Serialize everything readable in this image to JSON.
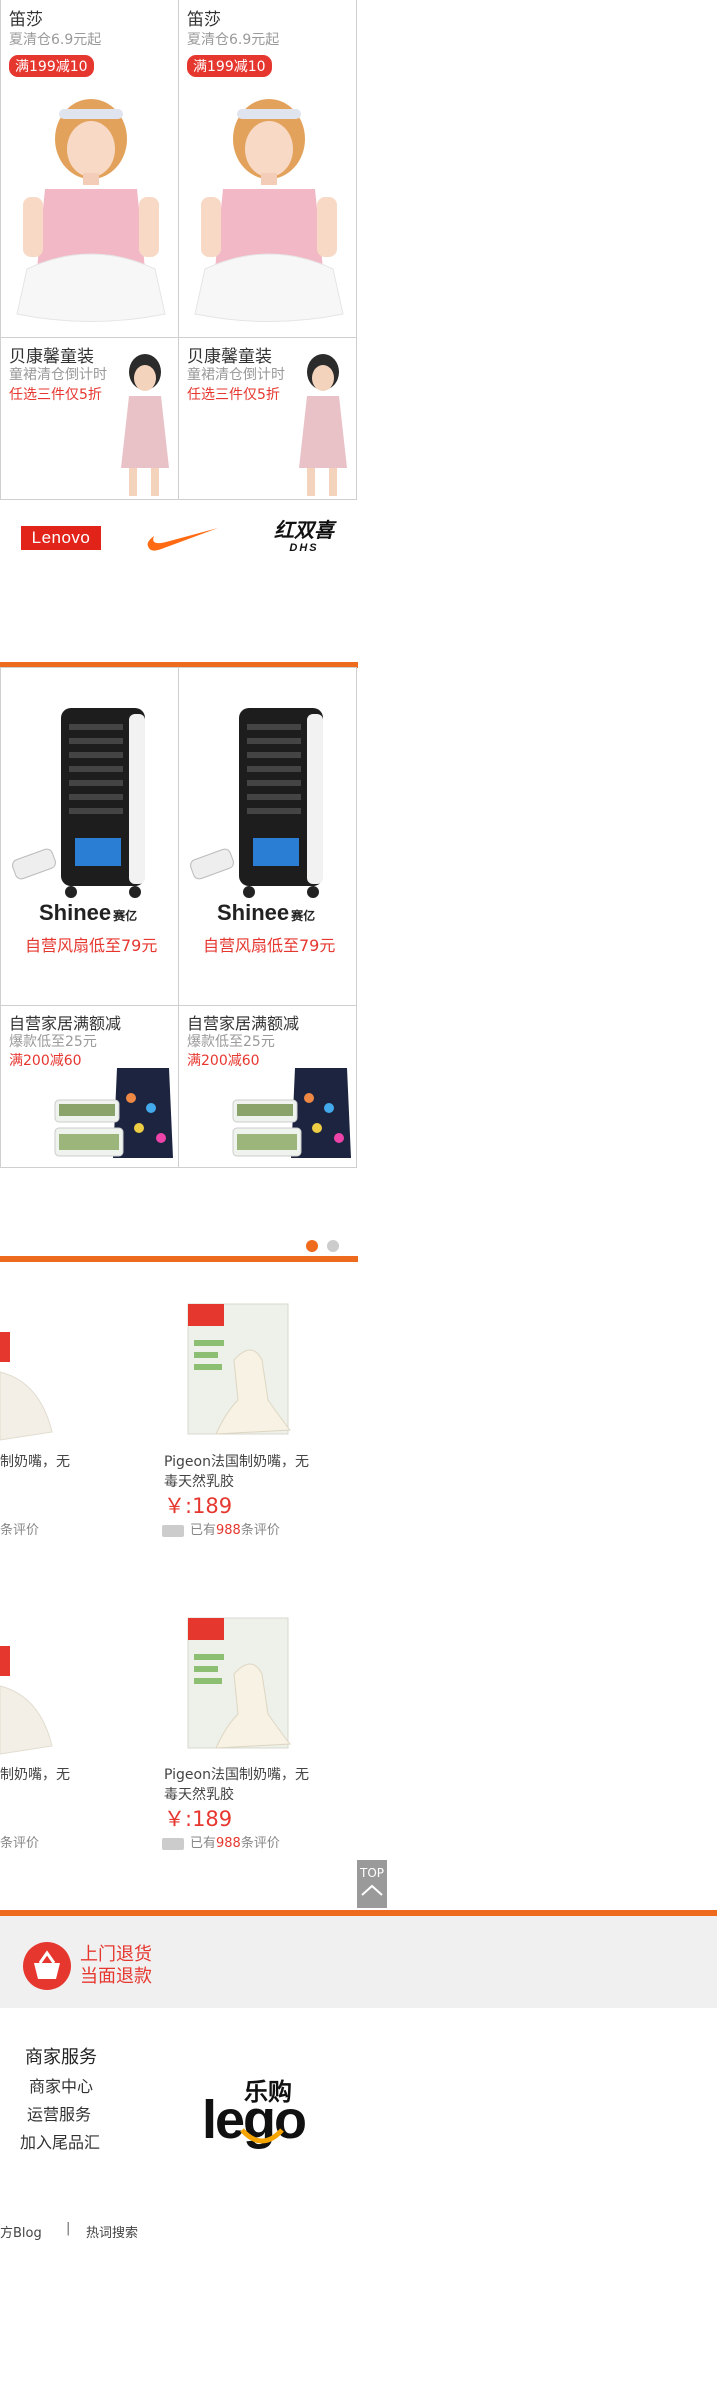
{
  "promo_top": {
    "cells": [
      {
        "title": "笛莎",
        "subtitle": "夏清仓6.9元起",
        "badge": "满199减10"
      },
      {
        "title": "笛莎",
        "subtitle": "夏清仓6.9元起",
        "badge": "满199减10"
      }
    ],
    "small_cells": [
      {
        "title": "贝康馨童装",
        "subtitle": "童裙清仓倒计时",
        "promo": "任选三件仅5折"
      },
      {
        "title": "贝康馨童装",
        "subtitle": "童裙清仓倒计时",
        "promo": "任选三件仅5折"
      }
    ]
  },
  "brands": [
    {
      "name": "Lenovo",
      "color": "#e2231a"
    },
    {
      "name": "nike-swoosh",
      "color": "#ff6a13"
    },
    {
      "name": "红双喜",
      "subtext": "DHS"
    }
  ],
  "appliance": {
    "cells": [
      {
        "brand_logo": "Shinee",
        "brand_cn": "赛亿",
        "promo": "自营风扇低至79元"
      },
      {
        "brand_logo": "Shinee",
        "brand_cn": "赛亿",
        "promo": "自营风扇低至79元"
      }
    ],
    "small_cells": [
      {
        "title": "自营家居满额减",
        "subtitle": "爆款低至25元",
        "promo": "满200减60"
      },
      {
        "title": "自营家居满额减",
        "subtitle": "爆款低至25元",
        "promo": "满200减60"
      }
    ]
  },
  "carousel": {
    "dots": 2,
    "active": 0,
    "active_color": "#ee6b1d",
    "inactive_color": "#cccccc"
  },
  "products": [
    {
      "title_partial": "制奶嘴，无",
      "reviews_partial": "条评价"
    },
    {
      "title": "Pigeon法国制奶嘴，无毒天然乳胶",
      "price": "￥:189",
      "reviews_prefix": "已有",
      "reviews_count": "988",
      "reviews_suffix": "条评价"
    },
    {
      "title_partial": "制奶嘴，无",
      "reviews_partial": "条评价"
    },
    {
      "title": "Pigeon法国制奶嘴，无毒天然乳胶",
      "price": "￥:189",
      "reviews_prefix": "已有",
      "reviews_count": "988",
      "reviews_suffix": "条评价"
    }
  ],
  "top_button": {
    "label": "TOP"
  },
  "service_banner": {
    "line1": "上门退货",
    "line2": "当面退款"
  },
  "footer": {
    "heading": "商家服务",
    "links": [
      "商家中心",
      "运营服务",
      "加入尾品汇"
    ],
    "logo_cn": "乐购",
    "logo_en": "lego"
  },
  "bottom_links": {
    "left": "方Blog",
    "separator": "|",
    "right": "热词搜索"
  },
  "colors": {
    "accent": "#ee6b1d",
    "red": "#e6372f"
  }
}
